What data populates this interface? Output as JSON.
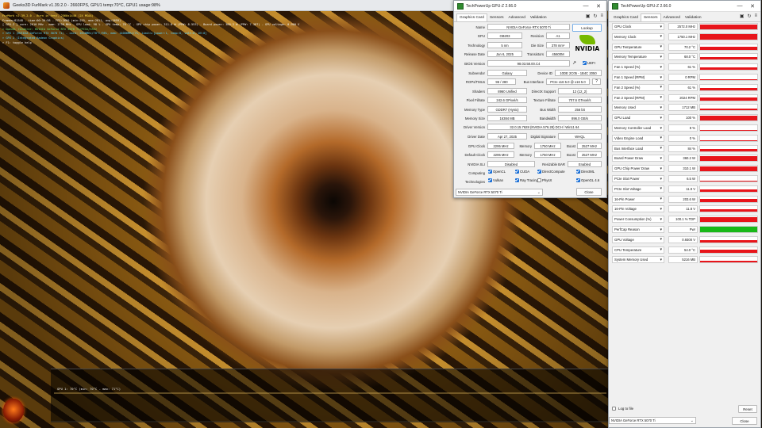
{
  "furmark": {
    "window_title": "Geeks3D FurMark v1.39.2.0 - 2660FPS, GPU1 temp:70°C, GPU1 usage:98%",
    "osd_lines": [
      {
        "text": "FurMark v1.39.2.0 - Burn in test, 2560x1440 (2X MSAA)",
        "color": "yellow"
      },
      {
        "text": "Frames:81548 - time:00:30:58 - FPS:2660 (min:255, max:2811, avg:2659)",
        "color": "white"
      },
      {
        "text": "[ GPU-Z ] core: 2610 MHz - mem: 1750 MHz - GPU load: 98 % - GPU temp: 70 °C - GPU chip power: 311.0 W (PPW: 8.553) - Board power: 360.2 W (PPW: 7.387) - GPU voltage: 0.960 V",
        "color": "white"
      },
      {
        "text": "> OpenGL renderer: NVIDIA GeForce RTX 5070 Ti/PCIe/SSE2",
        "color": "green"
      },
      {
        "text": "> GPU 1 (NVIDIA GeForce RTX 5070 Ti) - core: 2610MHz/70°C/98%, mem: 14000MHz/7%, limits:[power:1, temp:0, volt:0, OV:0]",
        "color": "cyan"
      },
      {
        "text": "> GPU 2 (Integrated Radeon Graphics)",
        "color": "cyan"
      },
      {
        "text": "> F1: toggle help",
        "color": "white"
      }
    ],
    "graph_label": "GPU 1: 70°C (min: 70°C - max: 71°C)"
  },
  "gpuz_card": {
    "window_title": "TechPowerUp GPU-Z 2.66.0",
    "tabs": [
      "Graphics Card",
      "Sensors",
      "Advanced",
      "Validation"
    ],
    "active_tab": "Graphics Card",
    "lookup_label": "Lookup",
    "uefi_label": "UEFI",
    "fields": {
      "name": {
        "label": "Name",
        "value": "NVIDIA GeForce RTX 5070 Ti"
      },
      "gpu": {
        "label": "GPU",
        "value": "GB203"
      },
      "revision": {
        "label": "Revision",
        "value": "A1"
      },
      "technology": {
        "label": "Technology",
        "value": "5 nm"
      },
      "die_size": {
        "label": "Die Size",
        "value": "378 mm²"
      },
      "release_date": {
        "label": "Release Date",
        "value": "Jan 6, 2025"
      },
      "transistors": {
        "label": "Transistors",
        "value": "45600M"
      },
      "bios_version": {
        "label": "BIOS Version",
        "value": "98.03.58.00.C4"
      },
      "subvendor": {
        "label": "Subvendor",
        "value": "Galaxy"
      },
      "device_id": {
        "label": "Device ID",
        "value": "10DE 2C05 - 1B4C 2050"
      },
      "rops_tmus": {
        "label": "ROPs/TMUs",
        "value": "96 / 280"
      },
      "bus_interface": {
        "label": "Bus Interface",
        "value": "PCIe x16 5.0 @ x16 5.0"
      },
      "shaders": {
        "label": "Shaders",
        "value": "8960 Unified"
      },
      "directx": {
        "label": "DirectX Support",
        "value": "12 (12_2)"
      },
      "pixel_fillrate": {
        "label": "Pixel Fillrate",
        "value": "242.6 GPixel/s"
      },
      "texture_fillrate": {
        "label": "Texture Fillrate",
        "value": "707.6 GTexel/s"
      },
      "memory_type": {
        "label": "Memory Type",
        "value": "GDDR7 (Hynix)"
      },
      "bus_width": {
        "label": "Bus Width",
        "value": "256 bit"
      },
      "memory_size": {
        "label": "Memory Size",
        "value": "16384 MB"
      },
      "bandwidth": {
        "label": "Bandwidth",
        "value": "896.0 GB/s"
      },
      "driver_version": {
        "label": "Driver Version",
        "value": "32.0.15.7628 (NVIDIA 576.28) DCH / Win11 64"
      },
      "driver_date": {
        "label": "Driver Date",
        "value": "Apr 27, 2025"
      },
      "digital_signature": {
        "label": "Digital Signature",
        "value": "WHQL"
      },
      "gpu_clock": {
        "label": "GPU Clock",
        "value": "2295 MHz"
      },
      "memory_clock": {
        "label": "Memory",
        "value": "1750 MHz"
      },
      "boost_clock": {
        "label": "Boost",
        "value": "2527 MHz"
      },
      "default_clock": {
        "label": "Default Clock",
        "value": "2295 MHz"
      },
      "default_memory": {
        "label": "Memory",
        "value": "1750 MHz"
      },
      "default_boost": {
        "label": "Boost",
        "value": "2527 MHz"
      },
      "nvidia_sli": {
        "label": "NVIDIA SLI",
        "value": "Disabled"
      },
      "resizable_bar": {
        "label": "Resizable BAR",
        "value": "Enabled"
      }
    },
    "computing_label": "Computing",
    "computing": [
      {
        "name": "OpenCL",
        "checked": true
      },
      {
        "name": "CUDA",
        "checked": true
      },
      {
        "name": "DirectCompute",
        "checked": true
      },
      {
        "name": "DirectML",
        "checked": true
      }
    ],
    "technologies_label": "Technologies",
    "technologies": [
      {
        "name": "Vulkan",
        "checked": true
      },
      {
        "name": "Ray Tracing",
        "checked": true
      },
      {
        "name": "PhysX",
        "checked": false
      },
      {
        "name": "OpenGL 4.6",
        "checked": true
      }
    ],
    "gpu_select": "NVIDIA GeForce RTX 5070 Ti",
    "close_label": "Close"
  },
  "gpuz_sensors": {
    "window_title": "TechPowerUp GPU-Z 2.66.0",
    "tabs": [
      "Graphics Card",
      "Sensors",
      "Advanced",
      "Validation"
    ],
    "active_tab": "Sensors",
    "colors": {
      "graph_red": "#e8141a",
      "graph_green": "#18b818",
      "accent_blue": "#1a6fd6"
    },
    "sensors": [
      {
        "name": "GPU Clock",
        "value": "2572.0 MHz",
        "level": 0.92,
        "color": "red"
      },
      {
        "name": "Memory Clock",
        "value": "1750.1 MHz",
        "level": 0.92,
        "color": "red"
      },
      {
        "name": "GPU Temperature",
        "value": "70.2 °C",
        "level": 0.55,
        "color": "red"
      },
      {
        "name": "Memory Temperature",
        "value": "68.0 °C",
        "level": 0.55,
        "color": "red"
      },
      {
        "name": "Fan 1 Speed (%)",
        "value": "61 %",
        "level": 0.45,
        "color": "red"
      },
      {
        "name": "Fan 1 Speed (RPM)",
        "value": "0 RPM",
        "level": 0.1,
        "color": "red"
      },
      {
        "name": "Fan 2 Speed (%)",
        "value": "61 %",
        "level": 0.45,
        "color": "red"
      },
      {
        "name": "Fan 2 Speed (RPM)",
        "value": "2024 RPM",
        "level": 0.45,
        "color": "red"
      },
      {
        "name": "Memory Used",
        "value": "1712 MB",
        "level": 0.35,
        "color": "red"
      },
      {
        "name": "GPU Load",
        "value": "100 %",
        "level": 0.95,
        "color": "red"
      },
      {
        "name": "Memory Controller Load",
        "value": "8 %",
        "level": 0.1,
        "color": "red"
      },
      {
        "name": "Video Engine Load",
        "value": "0 %",
        "level": 0.05,
        "color": "red"
      },
      {
        "name": "Bus Interface Load",
        "value": "84 %",
        "level": 0.4,
        "color": "red"
      },
      {
        "name": "Board Power Draw",
        "value": "360.2 W",
        "level": 0.9,
        "color": "red"
      },
      {
        "name": "GPU Chip Power Draw",
        "value": "310.1 W",
        "level": 0.85,
        "color": "red"
      },
      {
        "name": "PCIe Slot Power",
        "value": "6.5 W",
        "level": 0.2,
        "color": "red"
      },
      {
        "name": "PCIe Slot Voltage",
        "value": "11.9 V",
        "level": 0.45,
        "color": "red"
      },
      {
        "name": "16-Pin Power",
        "value": "203.6 W",
        "level": 0.45,
        "color": "red"
      },
      {
        "name": "16-Pin Voltage",
        "value": "11.8 V",
        "level": 0.45,
        "color": "red"
      },
      {
        "name": "Power Consumption (%)",
        "value": "100.1 % TDP",
        "level": 0.9,
        "color": "red"
      },
      {
        "name": "PerfCap Reason",
        "value": "Pwr",
        "level": 1.0,
        "color": "green"
      },
      {
        "name": "GPU Voltage",
        "value": "0.9300 V",
        "level": 0.45,
        "color": "red"
      },
      {
        "name": "CPU Temperature",
        "value": "54.0 °C",
        "level": 0.45,
        "color": "red"
      },
      {
        "name": "System Memory Used",
        "value": "5216 MB",
        "level": 0.4,
        "color": "red"
      }
    ],
    "log_to_file_label": "Log to file",
    "reset_label": "Reset",
    "gpu_select": "NVIDIA GeForce RTX 5070 Ti",
    "close_label": "Close"
  }
}
